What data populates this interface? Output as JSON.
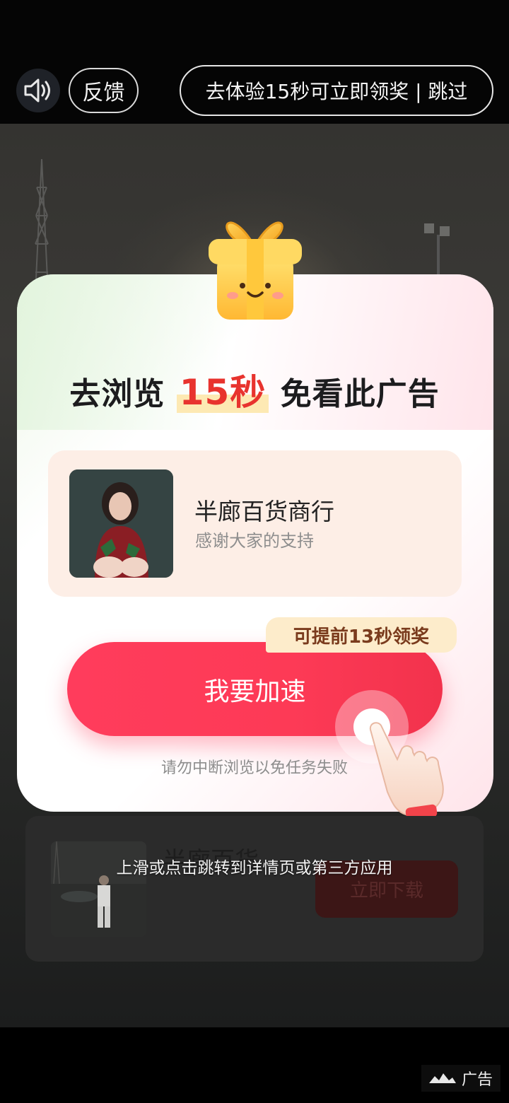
{
  "topbar": {
    "sound_icon": "speaker-icon",
    "feedback_label": "反馈",
    "skip_label": "去体验15秒可立即领奖 | 跳过"
  },
  "modal": {
    "headline_prefix": "去浏览",
    "headline_number": "15秒",
    "headline_suffix": "免看此广告",
    "app_name": "半廊百货商行",
    "app_desc": "感谢大家的支持",
    "early_tag": "可提前13秒领奖",
    "speed_button": "我要加速",
    "hint": "请勿中断浏览以免任务失败"
  },
  "ad_panel": {
    "title_faint": "半廊百货",
    "download_label": "立即下载",
    "swipe_hint": "上滑或点击跳转到详情页或第三方应用"
  },
  "footer": {
    "ad_label": "广告"
  },
  "colors": {
    "accent": "#ff3c5c",
    "highlight_number": "#e8332e",
    "tag_bg": "#fdeccb"
  }
}
